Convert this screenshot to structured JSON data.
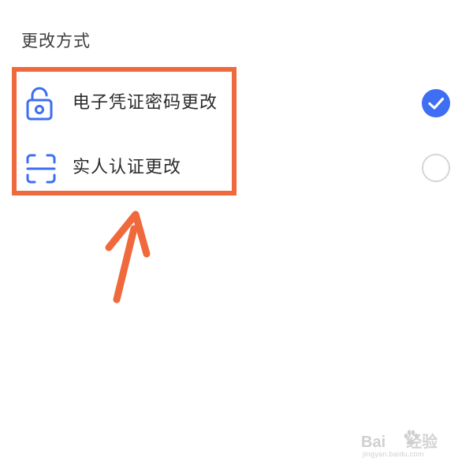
{
  "section": {
    "title": "更改方式"
  },
  "options": [
    {
      "label": "电子凭证密码更改",
      "icon": "unlock-icon",
      "selected": true
    },
    {
      "label": "实人认证更改",
      "icon": "face-scan-icon",
      "selected": false
    }
  ],
  "colors": {
    "accent": "#3d6ef3",
    "highlight": "#f0693c",
    "text": "#2b2b2b",
    "radio_border": "#d6d6d6"
  },
  "watermark": {
    "brand_left": "Bai",
    "brand_right": "经验",
    "url": "jingyan.baidu.com"
  }
}
